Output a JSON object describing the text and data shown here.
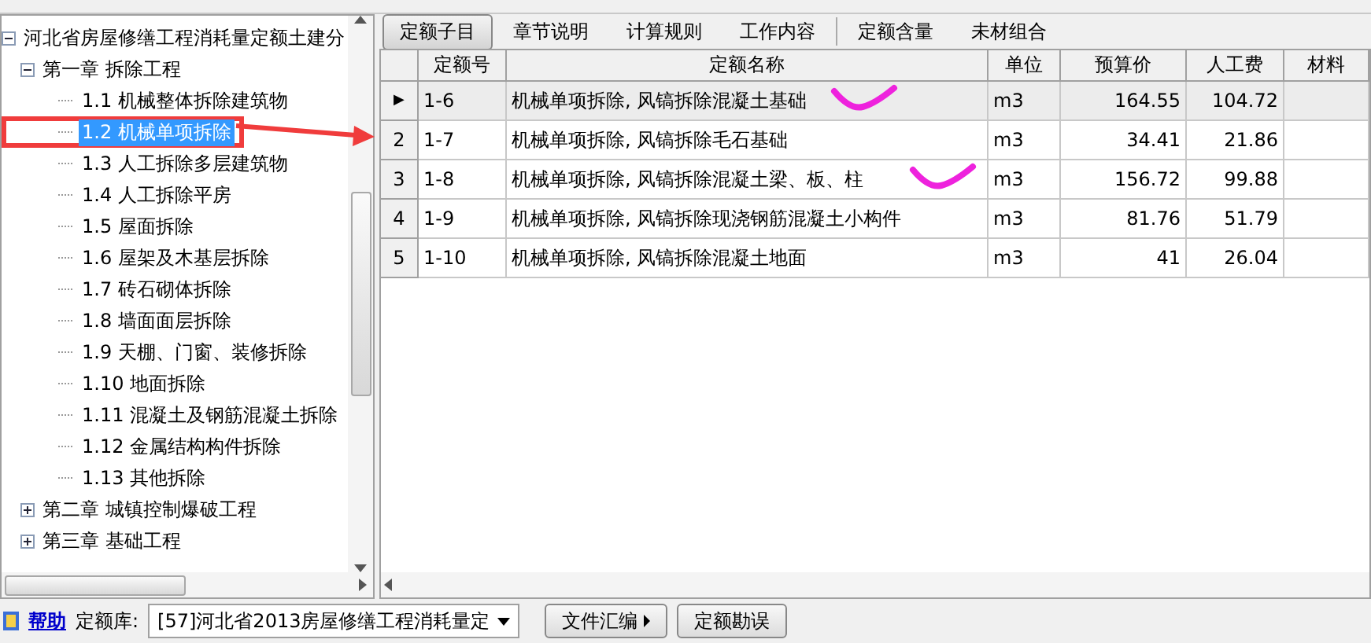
{
  "tree": [
    {
      "label": "河北省房屋修缮工程消耗量定额土建分",
      "expanded": true,
      "selected": false,
      "children": [
        {
          "label": "第一章  拆除工程",
          "expanded": true,
          "selected": false,
          "children": [
            {
              "label": "1.1 机械整体拆除建筑物",
              "selected": false
            },
            {
              "label": "1.2 机械单项拆除",
              "selected": true
            },
            {
              "label": "1.3 人工拆除多层建筑物",
              "selected": false
            },
            {
              "label": "1.4 人工拆除平房",
              "selected": false
            },
            {
              "label": "1.5 屋面拆除",
              "selected": false
            },
            {
              "label": "1.6 屋架及木基层拆除",
              "selected": false
            },
            {
              "label": "1.7 砖石砌体拆除",
              "selected": false
            },
            {
              "label": "1.8 墙面面层拆除",
              "selected": false
            },
            {
              "label": "1.9 天棚、门窗、装修拆除",
              "selected": false
            },
            {
              "label": "1.10 地面拆除",
              "selected": false
            },
            {
              "label": "1.11 混凝土及钢筋混凝土拆除",
              "selected": false
            },
            {
              "label": "1.12 金属结构构件拆除",
              "selected": false
            },
            {
              "label": "1.13 其他拆除",
              "selected": false
            }
          ]
        },
        {
          "label": "第二章  城镇控制爆破工程",
          "expanded": false,
          "selected": false
        },
        {
          "label": "第三章  基础工程",
          "expanded": false,
          "selected": false
        }
      ]
    }
  ],
  "tabs": [
    {
      "label": "定额子目",
      "selected": true
    },
    {
      "label": "章节说明",
      "selected": false
    },
    {
      "label": "计算规则",
      "selected": false
    },
    {
      "label": "工作内容",
      "selected": false
    },
    {
      "label": "定额含量",
      "selected": false
    },
    {
      "label": "未材组合",
      "selected": false
    }
  ],
  "table": {
    "columns": [
      "定额号",
      "定额名称",
      "单位",
      "预算价",
      "人工费",
      "材料"
    ],
    "rows": [
      {
        "marker": "▶",
        "selected": true,
        "cells": [
          "1-6",
          "机械单项拆除, 风镐拆除混凝土基础",
          "m3",
          "164.55",
          "104.72"
        ]
      },
      {
        "marker": "2",
        "selected": false,
        "cells": [
          "1-7",
          "机械单项拆除, 风镐拆除毛石基础",
          "m3",
          "34.41",
          "21.86"
        ]
      },
      {
        "marker": "3",
        "selected": false,
        "cells": [
          "1-8",
          "机械单项拆除, 风镐拆除混凝土梁、板、柱",
          "m3",
          "156.72",
          "99.88"
        ]
      },
      {
        "marker": "4",
        "selected": false,
        "cells": [
          "1-9",
          "机械单项拆除, 风镐拆除现浇钢筋混凝土小构件",
          "m3",
          "81.76",
          "51.79"
        ]
      },
      {
        "marker": "5",
        "selected": false,
        "cells": [
          "1-10",
          "机械单项拆除, 风镐拆除混凝土地面",
          "m3",
          "41",
          "26.04"
        ]
      }
    ]
  },
  "bottom": {
    "help": "帮助",
    "library_label": "定额库:",
    "library_value": "[57]河北省2013房屋修缮工程消耗量定",
    "buttons": [
      {
        "label": "文件汇编",
        "kind": "menu"
      },
      {
        "label": "定额勘误",
        "kind": "plain"
      }
    ]
  },
  "annotations": [
    {
      "kind": "box"
    },
    {
      "kind": "arrow"
    },
    {
      "kind": "check"
    },
    {
      "kind": "check"
    }
  ]
}
